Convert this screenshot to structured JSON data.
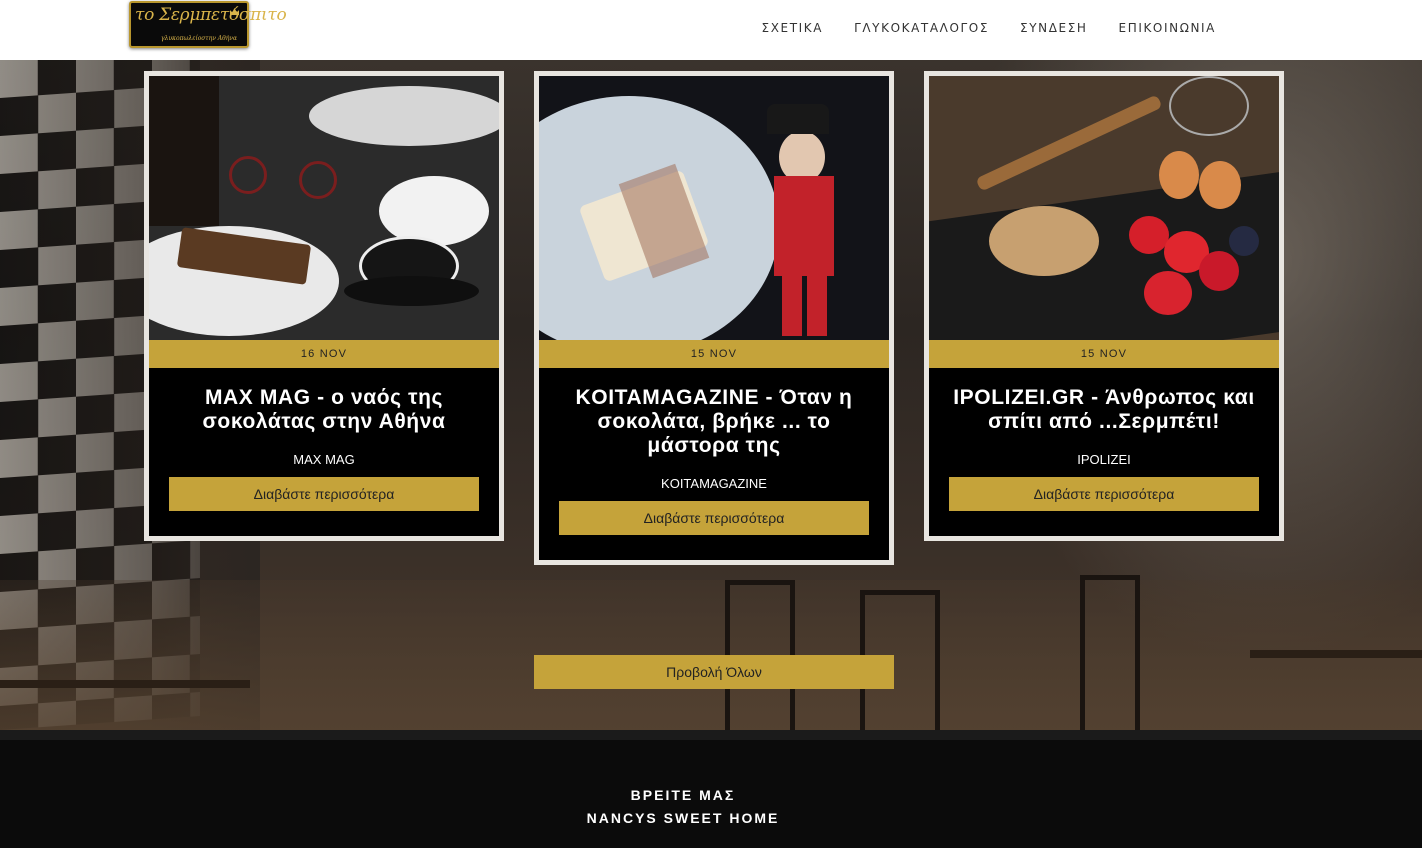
{
  "header": {
    "logo": {
      "script_text": "το Σερμπετόσπιτο",
      "left_text": "γλυκοπωλείο",
      "right_text": "στην Αθήνα"
    },
    "nav": [
      "ΣΧΕΤΙΚΑ",
      "ΓΛΥΚΟΚΑΤΑΛΟΓΟΣ",
      "ΣΥΝΔΕΣΗ",
      "ΕΠΙΚΟΙΝΩΝΙΑ"
    ]
  },
  "cards": [
    {
      "date": "16 NOV",
      "title": "MAX MAG - ο ναός της σοκολάτας στην Αθήνα",
      "source": "MAX MAG",
      "button": "Διαβάστε περισσότερα"
    },
    {
      "date": "15 NOV",
      "title": "KOITAMAGAZINE - Όταν η σοκολάτα, βρήκε ... το μάστορα της",
      "source": "KOITAMAGAZINE",
      "button": "Διαβάστε περισσότερα"
    },
    {
      "date": "15 NOV",
      "title": "IPOLIZEI.GR - Άνθρωπος και σπίτι από ...Σερμπέτι!",
      "source": "IPOLIZEI",
      "button": "Διαβάστε περισσότερα"
    }
  ],
  "view_all": "Προβολή Όλων",
  "footer": {
    "heading": "ΒΡΕΙΤΕ ΜΑΣ",
    "subheading": "NANCYS SWEET HOME"
  }
}
